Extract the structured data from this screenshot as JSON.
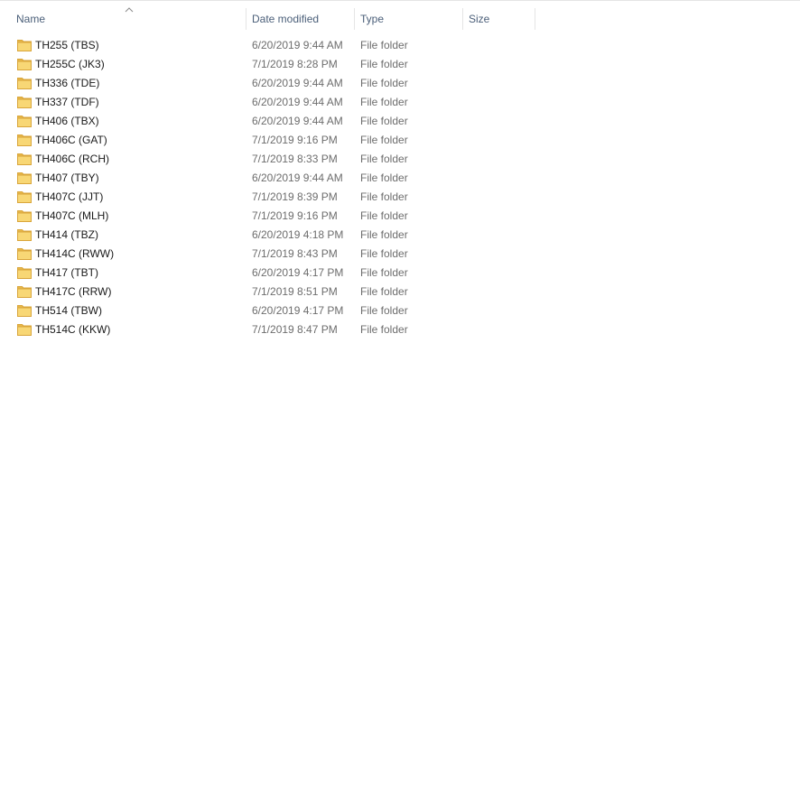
{
  "columns": {
    "name": "Name",
    "date_modified": "Date modified",
    "type": "Type",
    "size": "Size"
  },
  "sort": {
    "column": "name",
    "icon": "chevron-up-icon"
  },
  "folder_icon": {
    "name": "folder-icon",
    "fill": "#f8d775",
    "tab": "#e8b84a",
    "stroke": "#d9a53a"
  },
  "rows": [
    {
      "name": "TH255 (TBS)",
      "date": "6/20/2019 9:44 AM",
      "type": "File folder",
      "size": ""
    },
    {
      "name": "TH255C (JK3)",
      "date": "7/1/2019 8:28 PM",
      "type": "File folder",
      "size": ""
    },
    {
      "name": "TH336 (TDE)",
      "date": "6/20/2019 9:44 AM",
      "type": "File folder",
      "size": ""
    },
    {
      "name": "TH337 (TDF)",
      "date": "6/20/2019 9:44 AM",
      "type": "File folder",
      "size": ""
    },
    {
      "name": "TH406 (TBX)",
      "date": "6/20/2019 9:44 AM",
      "type": "File folder",
      "size": ""
    },
    {
      "name": "TH406C (GAT)",
      "date": "7/1/2019 9:16 PM",
      "type": "File folder",
      "size": ""
    },
    {
      "name": "TH406C (RCH)",
      "date": "7/1/2019 8:33 PM",
      "type": "File folder",
      "size": ""
    },
    {
      "name": "TH407 (TBY)",
      "date": "6/20/2019 9:44 AM",
      "type": "File folder",
      "size": ""
    },
    {
      "name": "TH407C (JJT)",
      "date": "7/1/2019 8:39 PM",
      "type": "File folder",
      "size": ""
    },
    {
      "name": "TH407C (MLH)",
      "date": "7/1/2019 9:16 PM",
      "type": "File folder",
      "size": ""
    },
    {
      "name": "TH414 (TBZ)",
      "date": "6/20/2019 4:18 PM",
      "type": "File folder",
      "size": ""
    },
    {
      "name": "TH414C (RWW)",
      "date": "7/1/2019 8:43 PM",
      "type": "File folder",
      "size": ""
    },
    {
      "name": "TH417 (TBT)",
      "date": "6/20/2019 4:17 PM",
      "type": "File folder",
      "size": ""
    },
    {
      "name": "TH417C (RRW)",
      "date": "7/1/2019 8:51 PM",
      "type": "File folder",
      "size": ""
    },
    {
      "name": "TH514 (TBW)",
      "date": "6/20/2019 4:17 PM",
      "type": "File folder",
      "size": ""
    },
    {
      "name": "TH514C (KKW)",
      "date": "7/1/2019 8:47 PM",
      "type": "File folder",
      "size": ""
    }
  ]
}
